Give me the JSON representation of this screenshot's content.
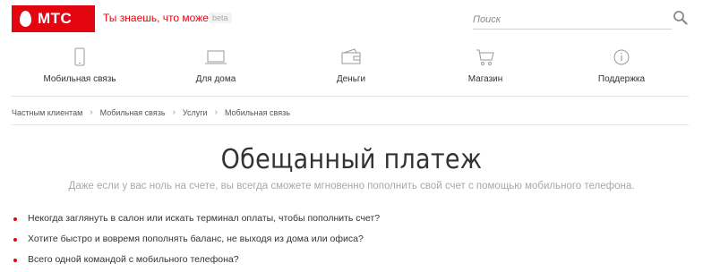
{
  "header": {
    "brand": "МТС",
    "slogan": "Ты знаешь, что можешь!",
    "beta": "beta",
    "search_placeholder": "Поиск",
    "accent_color": "#e30611"
  },
  "nav": [
    {
      "label": "Мобильная связь",
      "icon": "phone-icon"
    },
    {
      "label": "Для дома",
      "icon": "laptop-icon"
    },
    {
      "label": "Деньги",
      "icon": "wallet-icon"
    },
    {
      "label": "Магазин",
      "icon": "cart-icon"
    },
    {
      "label": "Поддержка",
      "icon": "info-icon"
    }
  ],
  "breadcrumb": [
    "Частным клиентам",
    "Мобильная связь",
    "Услуги",
    "Мобильная связь"
  ],
  "main": {
    "title": "Обещанный платеж",
    "subtitle": "Даже если у вас ноль на счете, вы всегда сможете мгновенно пополнить свой счет с помощью мобильного телефона.",
    "bullets": [
      "Некогда заглянуть в салон или искать терминал оплаты, чтобы пополнить счет?",
      "Хотите быстро и вовремя пополнять баланс, не выходя из дома или офиса?",
      "Всего одной командой с мобильного телефона?"
    ]
  }
}
